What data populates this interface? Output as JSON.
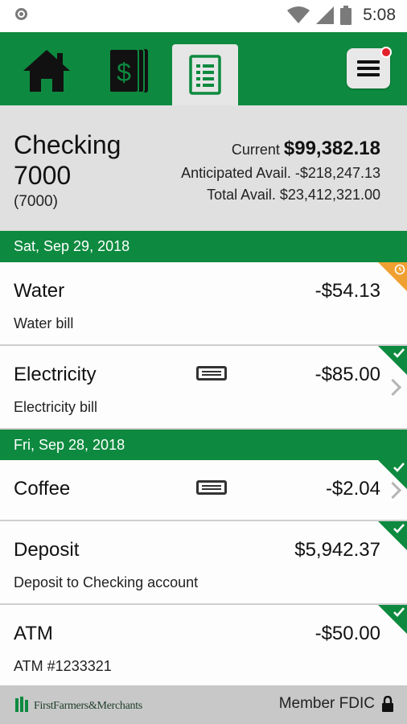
{
  "status": {
    "time": "5:08"
  },
  "nav": {
    "tabs": [
      {
        "icon": "home-icon"
      },
      {
        "icon": "money-icon"
      },
      {
        "icon": "register-icon",
        "active": true
      }
    ],
    "menu_icon": "hamburger-menu-icon",
    "menu_badge": true
  },
  "account": {
    "name": "Checking 7000",
    "number": "(7000)",
    "current_label": "Current",
    "current_value": "$99,382.18",
    "anticipated_label": "Anticipated Avail.",
    "anticipated_value": "-$218,247.13",
    "total_label": "Total Avail.",
    "total_value": "$23,412,321.00"
  },
  "dates": [
    "Sat, Sep 29, 2018",
    "Fri, Sep 28, 2018"
  ],
  "transactions": [
    {
      "name": "Water",
      "description": "Water bill",
      "amount": "-$54.13",
      "status": "pending"
    },
    {
      "name": "Electricity",
      "description": "Electricity bill",
      "amount": "-$85.00",
      "status": "cleared"
    },
    {
      "name": "Coffee",
      "description": "",
      "amount": "-$2.04",
      "status": "cleared"
    },
    {
      "name": "Deposit",
      "description": "Deposit to Checking account",
      "amount": "$5,942.37",
      "status": "cleared"
    },
    {
      "name": "ATM",
      "description": "ATM #1233321",
      "amount": "-$50.00",
      "status": "cleared"
    }
  ],
  "footer": {
    "logo_text": "FirstFarmers&Merchants",
    "fdic": "Member FDIC"
  },
  "colors": {
    "brand_green": "#0d8a3f",
    "pending_orange": "#f0a030",
    "badge_red": "#e3212b"
  }
}
